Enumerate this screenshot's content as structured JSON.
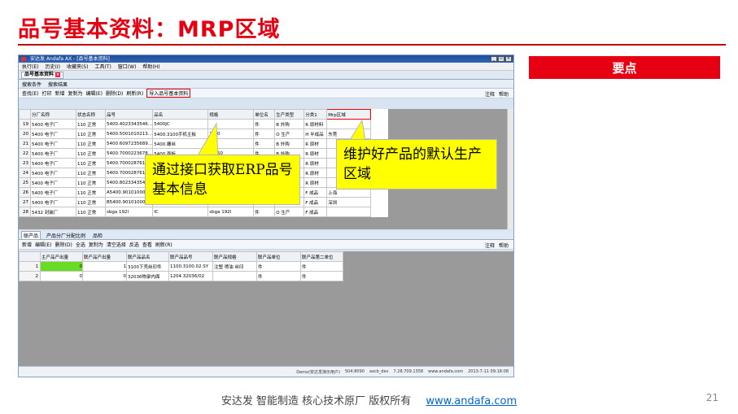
{
  "slide": {
    "title": "品号基本资料：MRP区域",
    "keypoint": "要点",
    "footer_text": "安达发  智能制造 核心技术原厂  版权所有",
    "footer_link": "www.andafa.com",
    "page_number": "21"
  },
  "colors": {
    "brand_red": "#e60012",
    "callout_yellow": "#ffff00",
    "highlight_green": "#66dd22"
  },
  "app": {
    "window_title": "安达发 Andafa AX - [品号基本资料]",
    "window_buttons": [
      "_",
      "▫",
      "×"
    ],
    "menu": [
      "执行(E)",
      "历史(I)",
      "收藏夹(S)",
      "工具(T)",
      "窗口(W)",
      "帮助(H)"
    ],
    "doc_tab": "品号基本资料",
    "search_tabs": [
      "搜索条件",
      "搜索结果"
    ],
    "toolbar": [
      "查找(E)",
      "打印",
      "新增",
      "复制为",
      "编辑(E)",
      "删除(D)",
      "刷新(R)",
      "导入品号基本资料"
    ],
    "toolbar_right": [
      "注释",
      "帮助"
    ],
    "grid": {
      "columns": [
        "",
        "分厂名称",
        "状态名称",
        "品号",
        "品名",
        "规格",
        "单位名",
        "生产类型",
        "分类1",
        "Mrp区域"
      ],
      "rows": [
        [
          "19",
          "5400 电子厂",
          "110 正常",
          "5400.4023343546...",
          "5400JC",
          "",
          "件",
          "B 外购",
          "R 原材料",
          ""
        ],
        [
          "20",
          "5400 电子厂",
          "110 正常",
          "5400.5001010213...",
          "5400.3100手机主板",
          "3*10",
          "件",
          "O 生产",
          "H 半成品",
          "东莞"
        ],
        [
          "21",
          "5400 电子厂",
          "110 正常",
          "5400.6097235689...",
          "5400.螺丝",
          "3*3",
          "件",
          "B 外购",
          "R 原材",
          ""
        ],
        [
          "22",
          "5400 电子厂",
          "110 正常",
          "5400.7000223678...",
          "5400.面板",
          "20*50",
          "件",
          "B 外购",
          "R 原材",
          ""
        ],
        [
          "23",
          "5400 电子厂",
          "110 正常",
          "5400.7000287611...",
          "",
          "",
          "件",
          "B 外购",
          "R 原材",
          ""
        ],
        [
          "24",
          "5400 电子厂",
          "110 正常",
          "5400.7000287611...",
          "",
          "",
          "件",
          "B 外购",
          "R 原材",
          ""
        ],
        [
          "25",
          "5400 电子厂",
          "110 正常",
          "5400.8023343546...",
          "",
          "",
          "件",
          "B 外购",
          "R 原材",
          ""
        ],
        [
          "26",
          "5400 电子厂",
          "110 正常",
          "A5400.901010000...",
          "",
          "",
          "件",
          "O 生产",
          "F 成品",
          "上海"
        ],
        [
          "27",
          "5400 电子厂",
          "110 正常",
          "B5400.901010000...",
          "5400.3100手机",
          "4.5寸(单色)",
          "件",
          "O 生产",
          "F 成品",
          "深圳"
        ],
        [
          "28",
          "5432 封装厂",
          "110 正常",
          "sbga 192l",
          "IC",
          "sbga 192l",
          "件",
          "O 生产",
          "F 成品",
          ""
        ]
      ]
    },
    "lower_tabs": [
      "联产品",
      "产品分厂分配比例",
      "品检"
    ],
    "lower_toolbar": [
      "新增",
      "编辑(E)",
      "删除(D)",
      "全选",
      "复制为",
      "清空选择",
      "反选",
      "查看",
      "刷新(R)"
    ],
    "lower_grid": {
      "columns": [
        "",
        "主产品产出量",
        "联产品产出量",
        "联产品品名",
        "联产品品号",
        "联产品规格",
        "联产品单位",
        "联产品第二单位"
      ],
      "rows": [
        [
          "1",
          "0",
          "1",
          "3100下壳丝印件",
          "1100.3100.02.SY",
          "注塑 喷油 丝印",
          "件",
          "件"
        ],
        [
          "2",
          "0",
          "0",
          "32036物录内面",
          "1204.32036/02",
          "",
          "件",
          "件"
        ]
      ]
    },
    "status": [
      "Demo(安达发演示用户)",
      "504:8090",
      "axcb_dev",
      "7.28.709.1358",
      "www.andafa.com",
      "2013-7-11 09:18:08"
    ]
  },
  "callouts": {
    "left": "通过接口获取ERP品号基本信息",
    "right": "维护好产品的默认生产区域"
  }
}
